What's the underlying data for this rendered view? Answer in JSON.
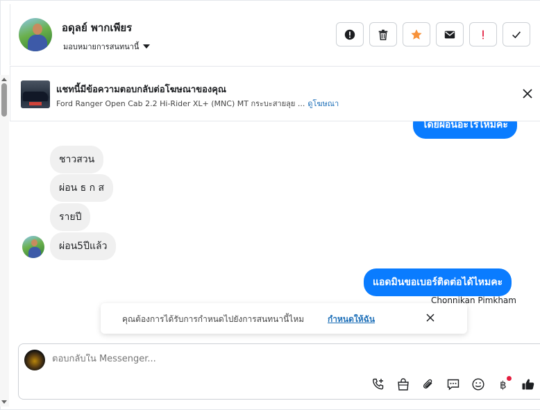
{
  "header": {
    "contact_name": "อดุลย์ พากเพียร",
    "assign_label": "มอบหมายการสนทนานี้",
    "actions": [
      {
        "name": "mark-spam-button",
        "icon": "alert-circle-icon"
      },
      {
        "name": "delete-button",
        "icon": "trash-icon"
      },
      {
        "name": "star-button",
        "icon": "star-icon",
        "color": "#f7923a"
      },
      {
        "name": "mark-unread-button",
        "icon": "envelope-icon"
      },
      {
        "name": "follow-up-button",
        "icon": "exclamation-icon",
        "color": "#e41e3f"
      },
      {
        "name": "mark-done-button",
        "icon": "checkmark-icon"
      }
    ]
  },
  "ad_banner": {
    "title": "แชทนี้มีข้อความตอบกลับต่อโฆษณาของคุณ",
    "product": "Ford Ranger Open Cab 2.2 Hi-Rider XL+ (MNC) MT กระบะสายลุย ...",
    "view_ad_link": "ดูโฆษณา"
  },
  "messages": {
    "partial_outgoing": "โดยผ่อนอะไรไหมคะ",
    "incoming": [
      "ชาวสวน",
      "ผ่อน ธ ก ส",
      "รายปี",
      "ผ่อน5ปีแล้ว"
    ],
    "outgoing_last": "แอดมินขอเบอร์ติดต่อได้ไหมคะ",
    "outgoing_sender": "Chonnikan Pimkham"
  },
  "assign_prompt": {
    "question": "คุณต้องการได้รับการกำหนดไปยังการสนทนานี้ไหม",
    "link": "กำหนดให้ฉัน"
  },
  "composer": {
    "placeholder": "ตอบกลับใน Messenger...",
    "tools": [
      "phone-add-icon",
      "shopping-bag-icon",
      "paperclip-icon",
      "saved-reply-icon",
      "emoji-icon",
      "baht-payment-icon",
      "thumbs-up-icon"
    ]
  },
  "colors": {
    "accent_blue": "#0a7cff",
    "link_blue": "#1d6fb8",
    "star_orange": "#f7923a",
    "alert_red": "#e41e3f"
  }
}
